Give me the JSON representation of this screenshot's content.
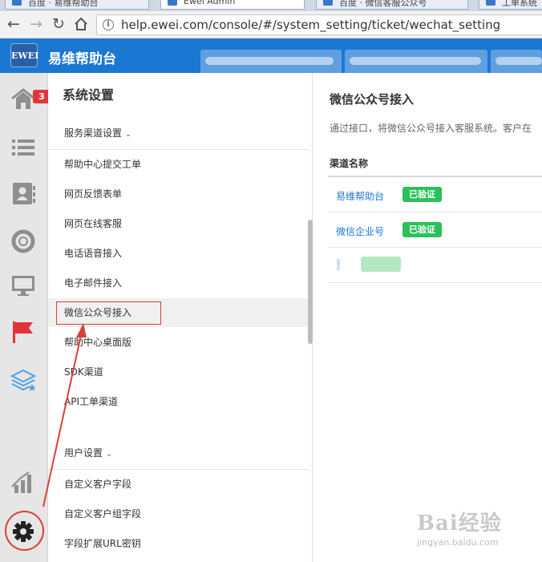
{
  "browser": {
    "tabs": [
      {
        "label": "百度 · 易维帮助台"
      },
      {
        "label": "Ewei Admin"
      },
      {
        "label": "百度 · 微信客服公众号"
      },
      {
        "label": "工单系统"
      }
    ],
    "url": "help.ewei.com/console/#/system_setting/ticket/wechat_setting"
  },
  "app": {
    "logo_text": "EWEI",
    "name": "易维帮助台",
    "notification_count": "3"
  },
  "sidebar": {
    "title": "系统设置",
    "sections": [
      {
        "label": "服务渠道设置",
        "items": [
          {
            "label": "帮助中心提交工单"
          },
          {
            "label": "网页反馈表单"
          },
          {
            "label": "网页在线客服"
          },
          {
            "label": "电话语音接入"
          },
          {
            "label": "电子邮件接入"
          },
          {
            "label": "微信公众号接入"
          },
          {
            "label": "帮助中心桌面版"
          },
          {
            "label": "SDK渠道"
          },
          {
            "label": "API工单渠道"
          }
        ]
      },
      {
        "label": "用户设置",
        "items": [
          {
            "label": "自定义客户字段"
          },
          {
            "label": "自定义客户组字段"
          },
          {
            "label": "字段扩展URL密钥"
          }
        ]
      }
    ]
  },
  "main": {
    "title": "微信公众号接入",
    "description": "通过接口，将微信公众号接入客服系统。客户在",
    "table_header": "渠道名称",
    "rows": [
      {
        "name": "易维帮助台",
        "status": "已验证"
      },
      {
        "name": "微信企业号",
        "status": "已验证"
      }
    ]
  },
  "watermark": {
    "main": "Bai经验",
    "sub": "jingyan.baidu.com"
  },
  "colors": {
    "brand": "#1b78d2",
    "badge": "#e0353a",
    "verified": "#2bc05a",
    "annotation": "#d9403a"
  }
}
